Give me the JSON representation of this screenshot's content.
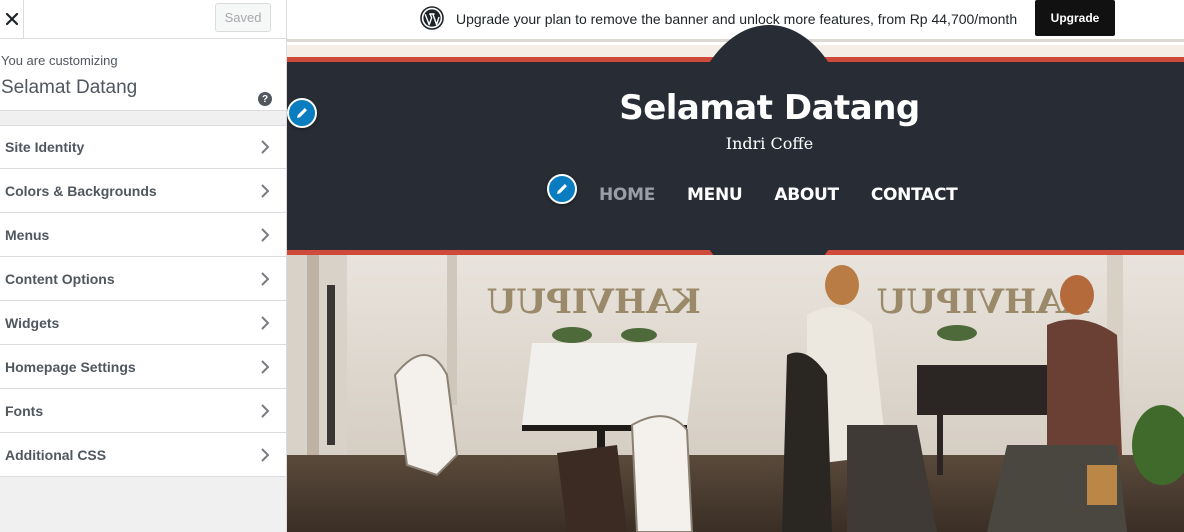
{
  "sidebar": {
    "close_label": "×",
    "saved_label": "Saved",
    "customizing_label": "You are customizing",
    "site_name": "Selamat Datang",
    "help_label": "?",
    "sections": [
      {
        "label": "Site Identity"
      },
      {
        "label": "Colors & Backgrounds"
      },
      {
        "label": "Menus"
      },
      {
        "label": "Content Options"
      },
      {
        "label": "Widgets"
      },
      {
        "label": "Homepage Settings"
      },
      {
        "label": "Fonts"
      },
      {
        "label": "Additional CSS"
      }
    ]
  },
  "banner": {
    "text": "Upgrade your plan to remove the banner and unlock more features, from Rp 44,700/month",
    "upgrade_label": "Upgrade"
  },
  "site": {
    "title": "Selamat Datang",
    "tagline": "Indri Coffe",
    "nav": [
      {
        "label": "HOME",
        "active": true
      },
      {
        "label": "MENU",
        "active": false
      },
      {
        "label": "ABOUT",
        "active": false
      },
      {
        "label": "CONTACT",
        "active": false
      }
    ]
  },
  "photo": {
    "window_text_left": "KAHVIPUU",
    "window_text_right": "KAHVIPUU"
  },
  "colors": {
    "header_bg": "#272c35",
    "accent_red": "#d04a3c",
    "edit_blue": "#0a7dc1"
  }
}
